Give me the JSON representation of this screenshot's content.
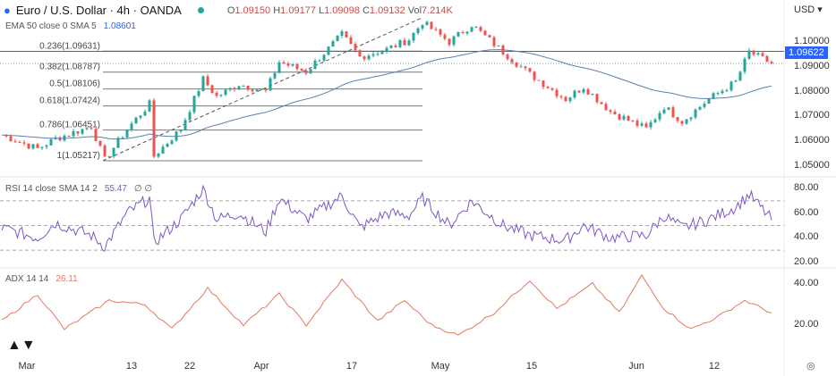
{
  "header": {
    "title": "Euro / U.S. Dollar · 4h · OANDA",
    "open": "1.09150",
    "high": "1.09177",
    "low": "1.09098",
    "close": "1.09132",
    "vol": "7.214K",
    "o_label": "O",
    "h_label": "H",
    "l_label": "L",
    "c_label": "C",
    "vol_label": "Vol"
  },
  "ema": {
    "label": "EMA 50 close 0 SMA 5",
    "value": "1.08601"
  },
  "rsi": {
    "label": "RSI 14 close SMA 14 2",
    "value": "55.47",
    "extra": "∅ ∅"
  },
  "adx": {
    "label": "ADX 14 14",
    "value": "26.11"
  },
  "currency": "USD ▾",
  "last_price": "1.09622",
  "colors": {
    "up": "#26a69a",
    "down": "#ef5350",
    "ema": "#5b7fb0",
    "rsi": "#7e57c2",
    "adx": "#e07a5f",
    "accent": "#2962ff"
  },
  "chart_data": {
    "type": "candlestick",
    "price_axis": {
      "ticks": [
        "1.10000",
        "1.09000",
        "1.08000",
        "1.07000",
        "1.06000",
        "1.05000"
      ],
      "range": [
        1.046,
        1.112
      ]
    },
    "rsi_axis": {
      "ticks": [
        "80.00",
        "60.00",
        "40.00",
        "20.00"
      ],
      "bands": [
        70,
        50,
        30
      ]
    },
    "adx_axis": {
      "ticks": [
        "40.00",
        "20.00"
      ]
    },
    "x_labels": [
      "Mar",
      "13",
      "22",
      "Apr",
      "17",
      "May",
      "15",
      "Jun",
      "12"
    ],
    "fib": [
      {
        "label": "0.236(1.09631)",
        "price": 1.09631
      },
      {
        "label": "0.382(1.08787)",
        "price": 1.08787
      },
      {
        "label": "0.5(1.08106)",
        "price": 1.08106
      },
      {
        "label": "0.618(1.07424)",
        "price": 1.07424
      },
      {
        "label": "0.786(1.06451)",
        "price": 1.06451
      },
      {
        "label": "1(1.05217)",
        "price": 1.05217
      }
    ],
    "price_keypoints": [
      [
        0,
        1.0625
      ],
      [
        8,
        1.057
      ],
      [
        12,
        1.061
      ],
      [
        20,
        1.066
      ],
      [
        23,
        1.0525
      ],
      [
        28,
        1.065
      ],
      [
        33,
        1.075
      ],
      [
        34,
        1.054
      ],
      [
        40,
        1.065
      ],
      [
        45,
        1.085
      ],
      [
        48,
        1.078
      ],
      [
        53,
        1.083
      ],
      [
        59,
        1.08
      ],
      [
        62,
        1.092
      ],
      [
        68,
        1.088
      ],
      [
        76,
        1.103
      ],
      [
        80,
        1.094
      ],
      [
        86,
        1.097
      ],
      [
        91,
        1.101
      ],
      [
        94,
        1.108
      ],
      [
        100,
        1.1
      ],
      [
        105,
        1.107
      ],
      [
        112,
        1.096
      ],
      [
        118,
        1.087
      ],
      [
        126,
        1.077
      ],
      [
        130,
        1.082
      ],
      [
        136,
        1.072
      ],
      [
        144,
        1.065
      ],
      [
        148,
        1.074
      ],
      [
        152,
        1.068
      ],
      [
        158,
        1.077
      ],
      [
        164,
        1.084
      ],
      [
        167,
        1.096
      ],
      [
        172,
        1.0913
      ]
    ],
    "rsi_keypoints": [
      [
        0,
        48
      ],
      [
        8,
        40
      ],
      [
        12,
        52
      ],
      [
        20,
        42
      ],
      [
        23,
        33
      ],
      [
        28,
        60
      ],
      [
        33,
        72
      ],
      [
        34,
        36
      ],
      [
        40,
        55
      ],
      [
        45,
        80
      ],
      [
        48,
        55
      ],
      [
        53,
        60
      ],
      [
        59,
        45
      ],
      [
        62,
        72
      ],
      [
        68,
        55
      ],
      [
        76,
        74
      ],
      [
        80,
        48
      ],
      [
        86,
        60
      ],
      [
        91,
        58
      ],
      [
        94,
        72
      ],
      [
        100,
        50
      ],
      [
        105,
        70
      ],
      [
        112,
        50
      ],
      [
        118,
        42
      ],
      [
        126,
        38
      ],
      [
        130,
        50
      ],
      [
        136,
        40
      ],
      [
        144,
        42
      ],
      [
        148,
        58
      ],
      [
        152,
        48
      ],
      [
        158,
        55
      ],
      [
        164,
        65
      ],
      [
        167,
        75
      ],
      [
        172,
        55
      ]
    ],
    "adx_keypoints": [
      [
        0,
        22
      ],
      [
        8,
        35
      ],
      [
        14,
        18
      ],
      [
        24,
        32
      ],
      [
        32,
        30
      ],
      [
        38,
        18
      ],
      [
        46,
        38
      ],
      [
        54,
        20
      ],
      [
        62,
        35
      ],
      [
        68,
        20
      ],
      [
        76,
        42
      ],
      [
        84,
        22
      ],
      [
        90,
        32
      ],
      [
        96,
        20
      ],
      [
        102,
        15
      ],
      [
        110,
        26
      ],
      [
        118,
        42
      ],
      [
        124,
        28
      ],
      [
        132,
        40
      ],
      [
        138,
        26
      ],
      [
        143,
        44
      ],
      [
        148,
        28
      ],
      [
        154,
        18
      ],
      [
        160,
        24
      ],
      [
        166,
        32
      ],
      [
        172,
        26
      ]
    ]
  }
}
